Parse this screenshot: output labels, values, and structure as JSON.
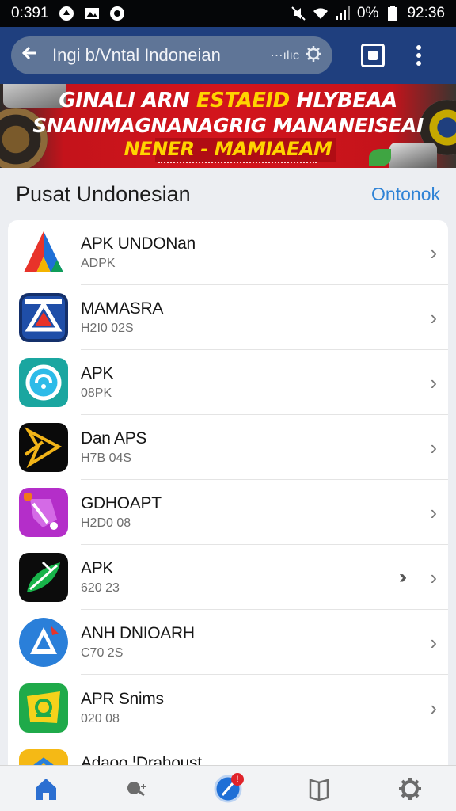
{
  "status_bar": {
    "time": "0:391",
    "battery": "0%",
    "clock": "92:36"
  },
  "app_bar": {
    "back_icon": "arrow-left-icon",
    "search_query": "Ingi b/Vntal  Indoneian",
    "search_suffix": "⋯ılıc",
    "tab_icon": "tab-switcher-icon",
    "menu_icon": "kebab-menu-icon"
  },
  "banner": {
    "line1_white": "GINALI ARN ",
    "line1_yellow": "ESTAEID",
    "line1_tail": " HLYBEAA",
    "line2": "SNANIMAGNANAGRIG  MANANEISEAI",
    "line3": "NENER - MAMIAEAM"
  },
  "section": {
    "title": "Pusat Undonesian",
    "action": "Ontonok"
  },
  "apps": [
    {
      "name": "APK UNDONan",
      "sub": "ADPK",
      "icon": "triangle-logo-icon"
    },
    {
      "name": "MAMASRA",
      "sub": "H2I0 02S",
      "icon": "shield-triangle-icon"
    },
    {
      "name": "APK",
      "sub": "08PK",
      "icon": "chat-refresh-icon"
    },
    {
      "name": "Dan APS",
      "sub": "H7B 04S",
      "icon": "star-play-icon"
    },
    {
      "name": "GDHOAPT",
      "sub": "H2D0 08",
      "icon": "game-controller-icon"
    },
    {
      "name": "APK",
      "sub": "620 23",
      "icon": "leaf-icon"
    },
    {
      "name": "ANH DNIOARH",
      "sub": "C70 2S",
      "icon": "drive-triangle-icon"
    },
    {
      "name": "APR Snims",
      "sub": "020 08",
      "icon": "map-face-icon"
    },
    {
      "name": "Adaoo ¦Drahoust",
      "sub": "",
      "icon": "partial-app-icon"
    }
  ],
  "bottom_nav": {
    "items": [
      {
        "icon": "home-icon",
        "active": true
      },
      {
        "icon": "search-people-icon",
        "active": false
      },
      {
        "icon": "compass-icon",
        "active": false,
        "badge": "!"
      },
      {
        "icon": "book-icon",
        "active": false
      },
      {
        "icon": "settings-gear-icon",
        "active": false
      }
    ]
  },
  "colors": {
    "app_bar": "#1f3f7e",
    "accent_link": "#2f83d6",
    "banner_red": "#d3151c",
    "banner_yellow": "#ffd400"
  }
}
